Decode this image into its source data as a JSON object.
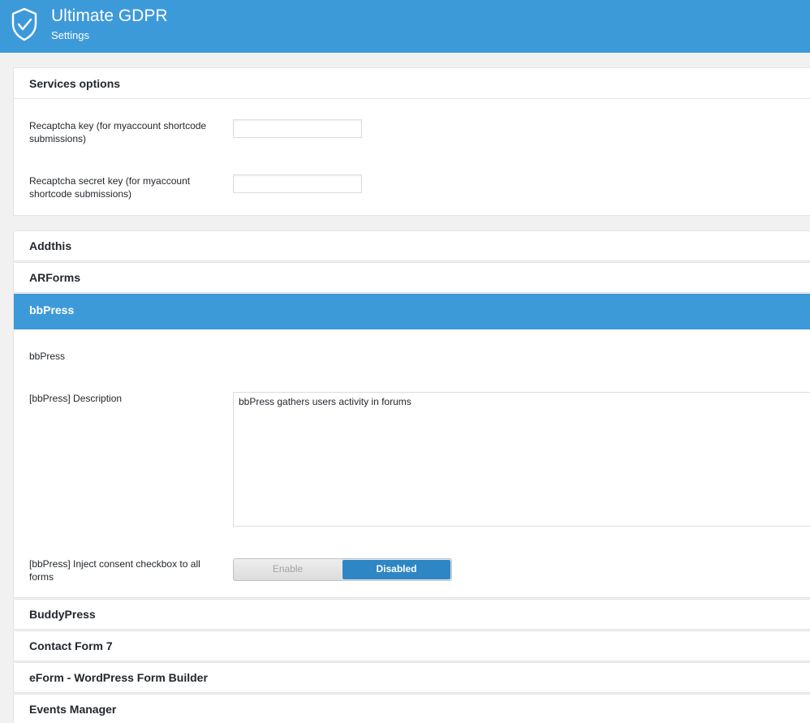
{
  "header": {
    "title": "Ultimate GDPR",
    "subtitle": "Settings"
  },
  "services_options": {
    "title": "Services options",
    "fields": [
      {
        "label": "Recaptcha key (for myaccount shortcode submissions)",
        "value": ""
      },
      {
        "label": "Recaptcha secret key (for myaccount shortcode submissions)",
        "value": ""
      }
    ]
  },
  "sections": {
    "addthis": "Addthis",
    "arforms": "ARForms",
    "bbpress": {
      "title": "bbPress",
      "name_label": "bbPress",
      "description_label": "[bbPress] Description",
      "description_value": "bbPress gathers users activity in forums",
      "inject_label": "[bbPress] Inject consent checkbox to all forms",
      "toggle": {
        "enable_label": "Enable",
        "disabled_label": "Disabled",
        "selected": "Disabled"
      }
    },
    "buddypress": "BuddyPress",
    "contact_form_7": "Contact Form 7",
    "eform": "eForm - WordPress Form Builder",
    "events_manager": "Events Manager"
  },
  "colors": {
    "accent": "#3d9ad9",
    "toggle_active": "#2f86c4"
  }
}
